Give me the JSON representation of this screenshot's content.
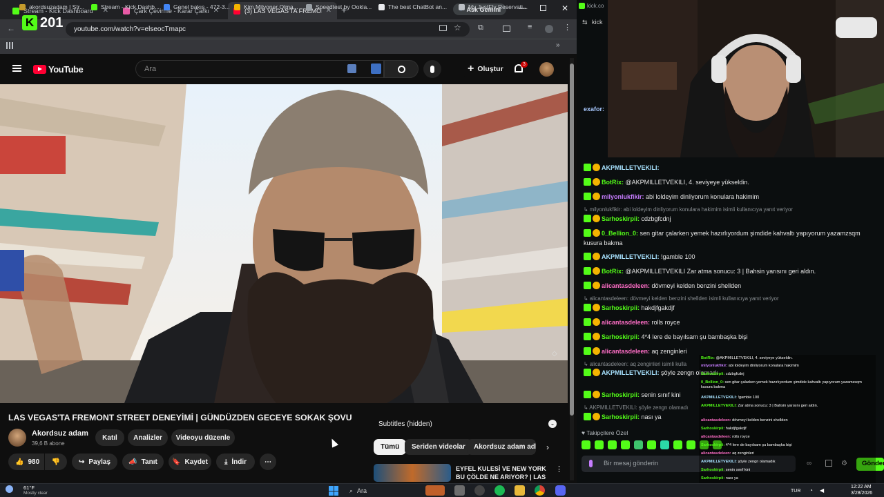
{
  "browser": {
    "tabs": [
      {
        "label": "Stream - Kick Dashboard",
        "color": "#53fc18"
      },
      {
        "label": "Çark Çevirme - Karar Çarkı",
        "color": "#e85aa6"
      },
      {
        "label": "(3) LAS VEGAS'TA FREMON",
        "color": "#ff0033"
      }
    ],
    "ask_gemini": "Ask Gemini",
    "url": "youtube.com/watch?v=elseocTmapc",
    "bookmarks": [
      {
        "label": "akordsuzadam | Str...",
        "color": "#c49a2c"
      },
      {
        "label": "Stream - Kick Dashb...",
        "color": "#53fc18"
      },
      {
        "label": "Genel bakış - 472-3...",
        "color": "#4285f4"
      },
      {
        "label": "Kim Milyoner Olma...",
        "color": "#f4b400"
      },
      {
        "label": "Speedtest by Ookla...",
        "color": "#9aa0a6"
      },
      {
        "label": "The best ChatBot an...",
        "color": "#e8eaed"
      },
      {
        "label": "My JustFly Reservati...",
        "color": "#bdc1c6"
      }
    ]
  },
  "overlay_counter": {
    "logo": "K",
    "value": "201"
  },
  "youtube": {
    "logo_text": "YouTube",
    "search_placeholder": "Ara",
    "create_label": "Oluştur",
    "notification_count": "3",
    "video_title": "LAS VEGAS'TA FREMONT STREET DENEYİMİ | GÜNDÜZDEN GECEYE SOKAK ŞOVU",
    "channel_name": "Akordsuz adam",
    "subscribers": "39,6 B abone",
    "buttons": {
      "join": "Katıl",
      "analytics": "Analizler",
      "edit": "Videoyu düzenle"
    },
    "likes": "980",
    "actions": {
      "share": "Paylaş",
      "promote": "Tanıt",
      "save": "Kaydet",
      "download": "İndir"
    },
    "subtitles_label": "Subtitles (hidden)",
    "chips": [
      "Tümü",
      "Seriden videolar",
      "Akordsuz adam adlı y"
    ],
    "reco_title_1": "EYFEL KULESİ VE NEW YORK",
    "reco_title_2": "BU ÇÖLDE NE ARIYOR? | LAS ..."
  },
  "chat": {
    "header_hint": "kick.co",
    "top_user": "exafor:",
    "messages": [
      {
        "user": "AKPMILLETVEKILI:",
        "text": "",
        "ucolor": "#a8e2ff"
      },
      {
        "user": "BotRix:",
        "text": "@AKPMILLETVEKILI, 4. seviyeye yükseldin.",
        "ucolor": "#53fc18"
      },
      {
        "user": "milyonlukfikir:",
        "text": "abi loldeyim dinliyorum konulara hakimim",
        "ucolor": "#c77dff"
      },
      {
        "user": "",
        "text": "milyonlukfikir: abi loldeyim dinliyorum konulara hakimim isimli kullanıcıya yanıt veriyor",
        "ucolor": "#8a8f93",
        "sys": true
      },
      {
        "user": "Sarhoskirpii:",
        "text": "cdzbgfcdnj",
        "ucolor": "#53fc18"
      },
      {
        "user": "0_Bellion_0:",
        "text": "sen gitar çalarken yemek hazırlıyordum şimdide kahvaltı yapıyorum yazamzsqm kusura bakma",
        "ucolor": "#53fc18"
      },
      {
        "user": "AKPMILLETVEKILI:",
        "text": "!gamble 100",
        "ucolor": "#a8e2ff"
      },
      {
        "user": "BotRix:",
        "text": "@AKPMILLETVEKILI Zar atma sonucu: 3 | Bahsin yarısını geri aldın.",
        "ucolor": "#53fc18"
      },
      {
        "user": "alicantasdeleen:",
        "text": "dövmeyi kelden benzini shellden",
        "ucolor": "#ff6ec7"
      },
      {
        "user": "",
        "text": "alicantasdeleen: dövmeyi kelden benzini shellden isimli kullanıcıya yanıt veriyor",
        "ucolor": "#8a8f93",
        "sys": true
      },
      {
        "user": "Sarhoskirpii:",
        "text": "hakdjfgakdjf",
        "ucolor": "#53fc18"
      },
      {
        "user": "alicantasdeleen:",
        "text": "rolls royce",
        "ucolor": "#ff6ec7"
      },
      {
        "user": "Sarhoskirpii:",
        "text": "4*4 lere de bayılsam şu bambaşka bişi",
        "ucolor": "#53fc18"
      },
      {
        "user": "alicantasdeleen:",
        "text": "aq zenginleri",
        "ucolor": "#ff6ec7"
      },
      {
        "user": "",
        "text": "alicantasdeleen: aq zenginleri isimli kulla",
        "ucolor": "#8a8f93",
        "sys": true
      },
      {
        "user": "AKPMILLETVEKILI:",
        "text": "şöyle zengn olamadı",
        "ucolor": "#a8e2ff"
      },
      {
        "user": "Sarhoskirpii:",
        "text": "senin sınıf kini",
        "ucolor": "#53fc18"
      },
      {
        "user": "",
        "text": "AKPMILLETVEKILI: şöyle zengn olamadı",
        "ucolor": "#8a8f93",
        "sys": true
      },
      {
        "user": "Sarhoskirpii:",
        "text": "nası ya",
        "ucolor": "#53fc18"
      }
    ],
    "followers_label": "Takipçilere Özel",
    "input_placeholder": "Bir mesaj gönderin",
    "send_label": "Gönder",
    "overlay_messages": [
      {
        "user": "BotRix:",
        "text": "@AKPMILLETVEKILI, 4. seviyeye yükseldin.",
        "ucolor": "#53fc18"
      },
      {
        "user": "milyonlukfikir:",
        "text": "abi loldeyim dinliyorum konulara hakimim",
        "ucolor": "#c77dff"
      },
      {
        "user": "Sarhoskirpii:",
        "text": "cdzbgfcdnj",
        "ucolor": "#53fc18"
      },
      {
        "user": "0_Bellion_0:",
        "text": "sen gitar çalarken yemek hazırlıyordum şimdide kahvaltı yapıyorum yazamzsqm kusura bakma",
        "ucolor": "#53fc18"
      },
      {
        "user": "AKPMILLETVEKILI:",
        "text": "!gamble 100",
        "ucolor": "#a8e2ff"
      },
      {
        "user": "AKPMILLETVEKILI:",
        "text": "Zar atma sonucu: 3 | Bahsin yarısını geri aldın.",
        "ucolor": "#53fc18"
      },
      {
        "user": "alicantasdeleen:",
        "text": "dövmeyi kelden benzini shellden",
        "ucolor": "#ff6ec7"
      },
      {
        "user": "Sarhoskirpii:",
        "text": "hakdjfgakdjf",
        "ucolor": "#53fc18"
      },
      {
        "user": "alicantasdeleen:",
        "text": "rolls royce",
        "ucolor": "#ff6ec7"
      },
      {
        "user": "Sarhoskirpii:",
        "text": "4*4 lere de bayılsam şu bambaşka bişi",
        "ucolor": "#53fc18"
      },
      {
        "user": "alicantasdeleen:",
        "text": "aq zenginleri",
        "ucolor": "#ff6ec7"
      },
      {
        "user": "AKPMILLETVEKILI:",
        "text": "şöyle zengn olamadık",
        "ucolor": "#a8e2ff"
      },
      {
        "user": "Sarhoskirpii:",
        "text": "senin sınıf kini",
        "ucolor": "#53fc18"
      },
      {
        "user": "Sarhoskirpii:",
        "text": "nası ya",
        "ucolor": "#53fc18"
      }
    ]
  },
  "taskbar": {
    "weather_temp": "61°F",
    "weather_desc": "Mostly clear",
    "search": "Ara",
    "lang": "TUR",
    "time": "12:22 AM",
    "date": "3/28/2026"
  },
  "colors": {
    "kick_green": "#53fc18",
    "yt_red": "#ff0033"
  }
}
